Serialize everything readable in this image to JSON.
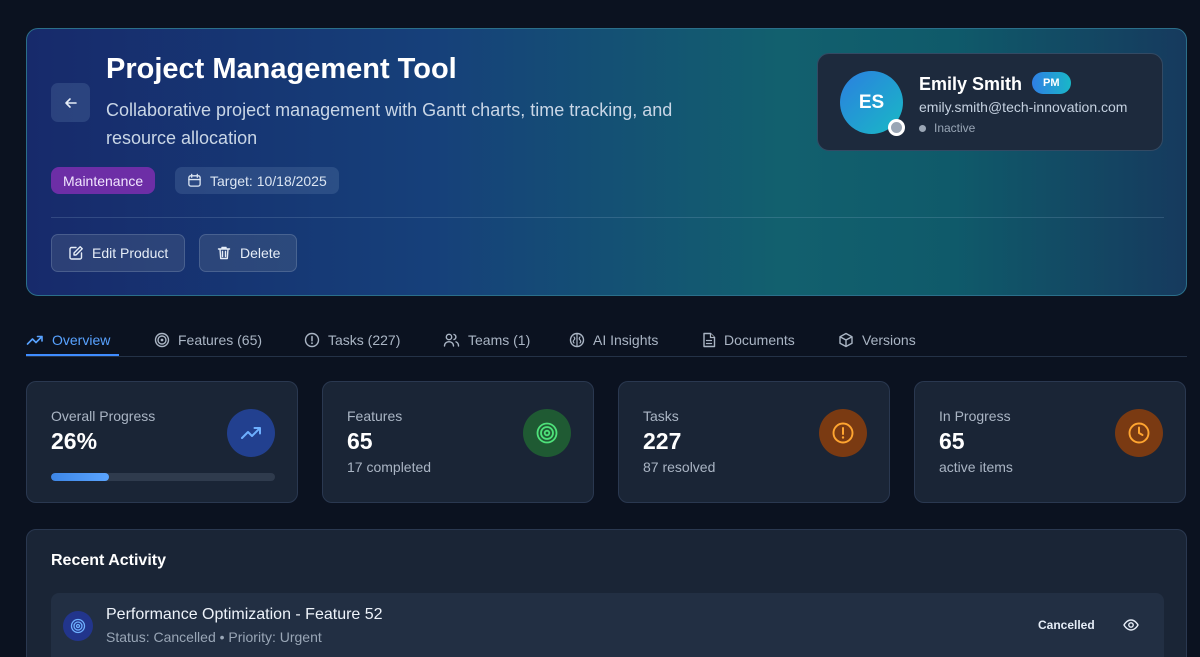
{
  "header": {
    "title": "Project Management Tool",
    "description": "Collaborative project management with Gantt charts, time tracking, and resource allocation",
    "status_tag": "Maintenance",
    "target_label": "Target: 10/18/2025",
    "edit_label": "Edit Product",
    "delete_label": "Delete"
  },
  "owner": {
    "initials": "ES",
    "name": "Emily Smith",
    "role": "PM",
    "email": "emily.smith@tech-innovation.com",
    "status": "Inactive"
  },
  "tabs": [
    {
      "label": "Overview",
      "icon": "trend-up-icon",
      "active": true
    },
    {
      "label": "Features (65)",
      "icon": "target-icon"
    },
    {
      "label": "Tasks (227)",
      "icon": "alert-circle-icon"
    },
    {
      "label": "Teams (1)",
      "icon": "users-icon"
    },
    {
      "label": "AI Insights",
      "icon": "brain-icon"
    },
    {
      "label": "Documents",
      "icon": "document-icon"
    },
    {
      "label": "Versions",
      "icon": "package-icon"
    }
  ],
  "stats": {
    "progress": {
      "label": "Overall Progress",
      "value": "26%",
      "fraction": 0.26
    },
    "features": {
      "label": "Features",
      "value": "65",
      "sub": "17 completed"
    },
    "tasks": {
      "label": "Tasks",
      "value": "227",
      "sub": "87 resolved"
    },
    "in_progress": {
      "label": "In Progress",
      "value": "65",
      "sub": "active items"
    }
  },
  "activity": {
    "title": "Recent Activity",
    "items": [
      {
        "title": "Performance Optimization - Feature 52",
        "meta": "Status: Cancelled • Priority: Urgent",
        "status": "Cancelled"
      }
    ]
  },
  "colors": {
    "accent": "#3f8cff",
    "maintenance_tag": "#6d2ea6",
    "features_icon_bg": "#1f5a33",
    "tasks_icon_bg": "#7a3a12",
    "in_progress_icon_bg": "#7a3a12",
    "progress_icon_bg": "#22408f"
  }
}
